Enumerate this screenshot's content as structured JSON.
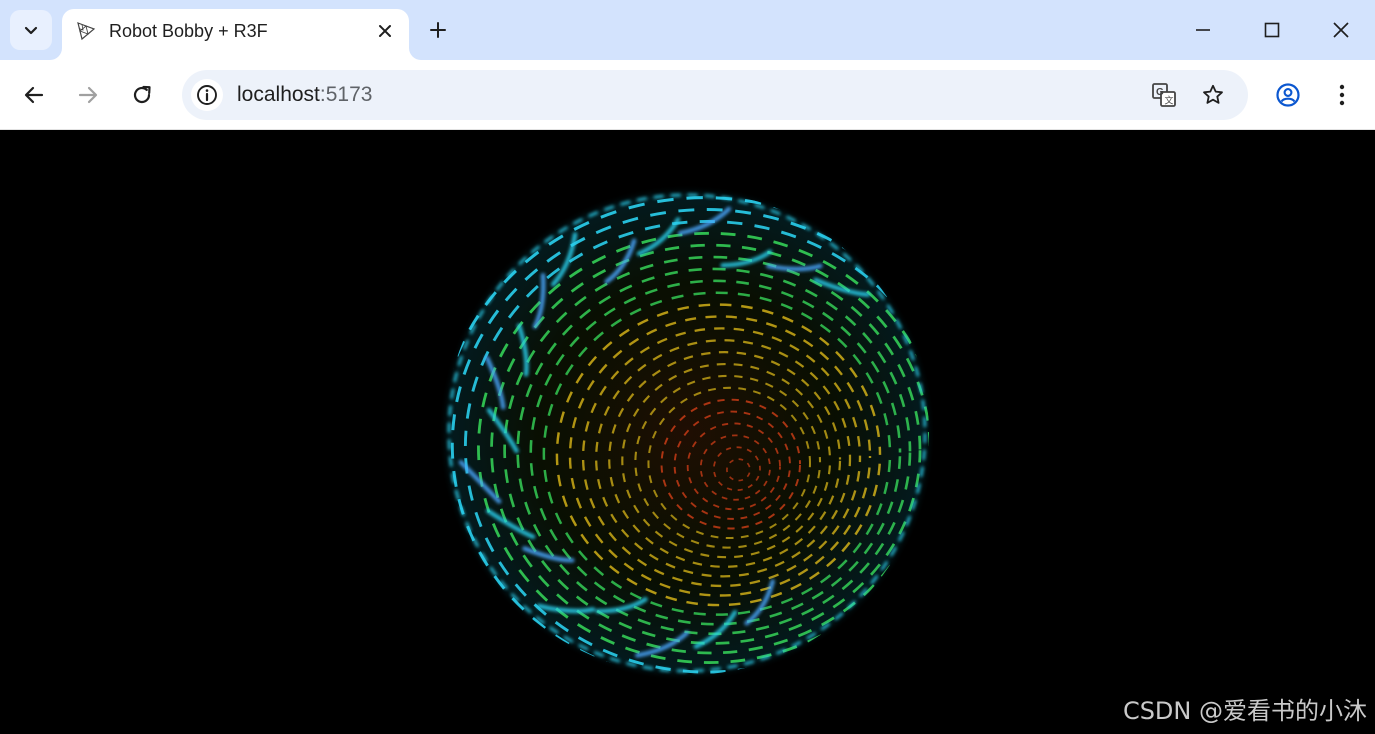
{
  "browser": {
    "tab": {
      "title": "Robot Bobby + R3F",
      "favicon": "threejs-logo-icon"
    },
    "icons": {
      "tab_search": "chevron-down-icon",
      "tab_close": "close-icon",
      "new_tab": "plus-icon",
      "minimize": "minimize-icon",
      "maximize": "maximize-icon",
      "close_window": "close-icon",
      "back": "back-arrow-icon",
      "forward": "forward-arrow-icon",
      "reload": "reload-icon",
      "site_info": "info-icon",
      "translate": "translate-icon",
      "bookmark": "star-icon",
      "profile": "account-icon",
      "menu": "more-vert-icon"
    },
    "address": {
      "host": "localhost",
      "port": ":5173"
    }
  },
  "page": {
    "scene": "particle-sphere",
    "colors": {
      "inner": "#ff4a1c",
      "mid": "#e8c21a",
      "outer": "#37d85a",
      "edge": "#2bd2f0",
      "streak": "#4aa8ff"
    },
    "watermark": "CSDN @爱看书的小沐"
  }
}
